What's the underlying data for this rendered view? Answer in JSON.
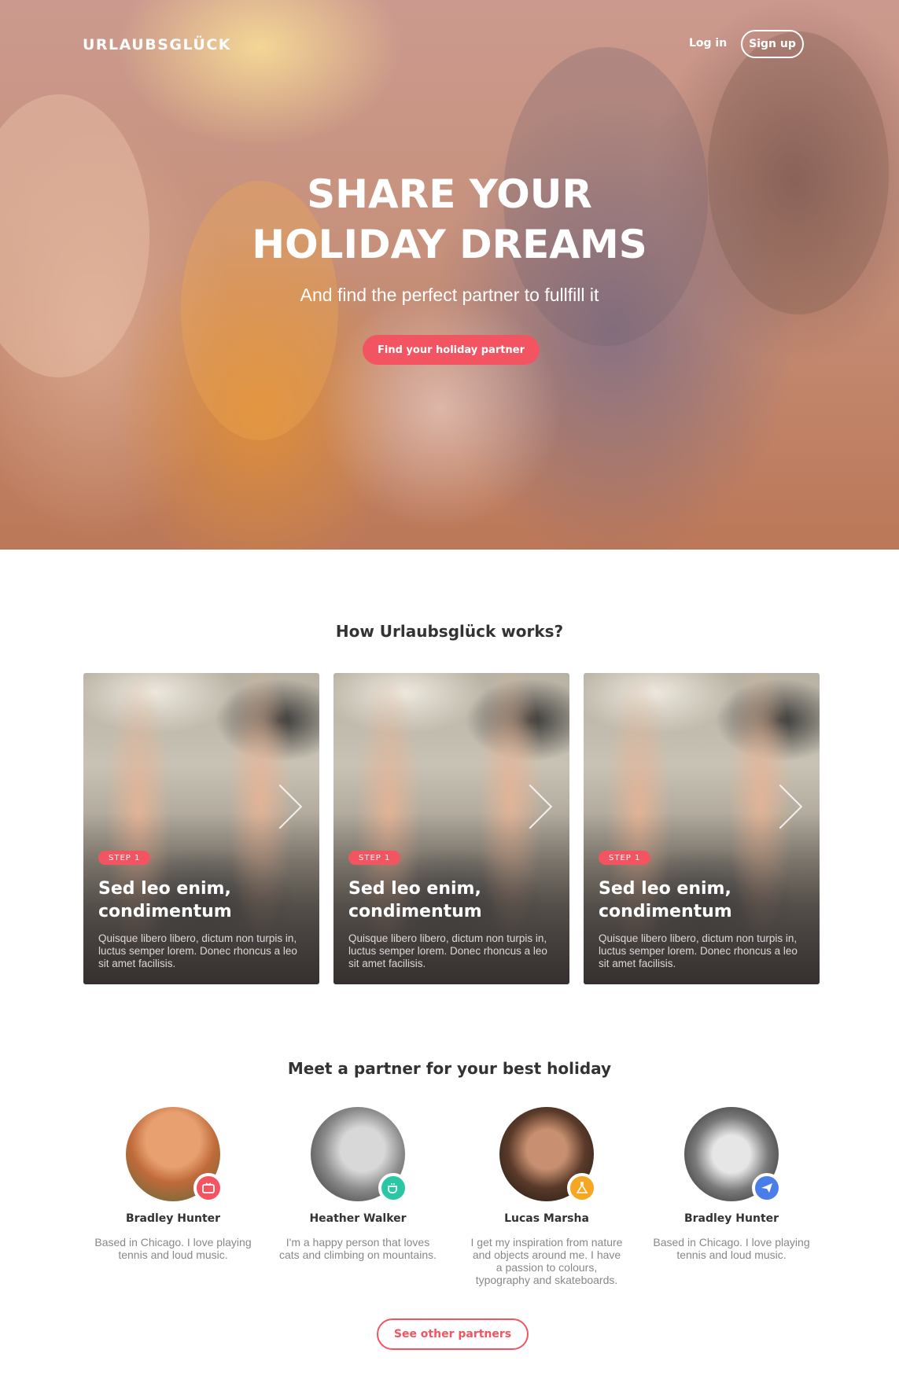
{
  "brand": "URLAUBSGLÜCK",
  "nav": {
    "login": "Log in",
    "signup": "Sign up"
  },
  "hero": {
    "title_line1": "SHARE YOUR",
    "title_line2": "HOLIDAY DREAMS",
    "subtitle": "And find the perfect partner to fullfill it",
    "cta": "Find your holiday partner"
  },
  "how": {
    "title": "How Urlaubsglück works?",
    "cards": [
      {
        "step": "STEP 1",
        "title": "Sed leo enim, condimentum",
        "text": "Quisque libero libero, dictum non turpis in, luctus semper lorem. Donec rhoncus a leo sit amet facilisis."
      },
      {
        "step": "STEP 1",
        "title": "Sed leo enim, condimentum",
        "text": "Quisque libero libero, dictum non turpis in, luctus semper lorem. Donec rhoncus a leo sit amet facilisis."
      },
      {
        "step": "STEP 1",
        "title": "Sed leo enim, condimentum",
        "text": "Quisque libero libero, dictum non turpis in, luctus semper lorem. Donec rhoncus a leo sit amet facilisis."
      }
    ]
  },
  "partners": {
    "title": "Meet a partner for your best holiday",
    "items": [
      {
        "name": "Bradley Hunter",
        "bio": "Based in Chicago. I love playing tennis and loud music.",
        "badge_icon": "tv-icon",
        "badge_color": "#f25561"
      },
      {
        "name": "Heather Walker",
        "bio": "I'm a happy person that loves cats and climbing on mountains.",
        "badge_icon": "coffee-cup-icon",
        "badge_color": "#2bc6a4"
      },
      {
        "name": "Lucas Marsha",
        "bio": "I get my inspiration from nature and objects around me. I have a passion to colours, typography and skateboards.",
        "badge_icon": "flask-icon",
        "badge_color": "#f5a623"
      },
      {
        "name": "Bradley Hunter",
        "bio": "Based in Chicago. I love playing tennis and loud music.",
        "badge_icon": "paper-plane-icon",
        "badge_color": "#4a7de8"
      }
    ],
    "more": "See other partners"
  },
  "colors": {
    "accent": "#f25561"
  }
}
